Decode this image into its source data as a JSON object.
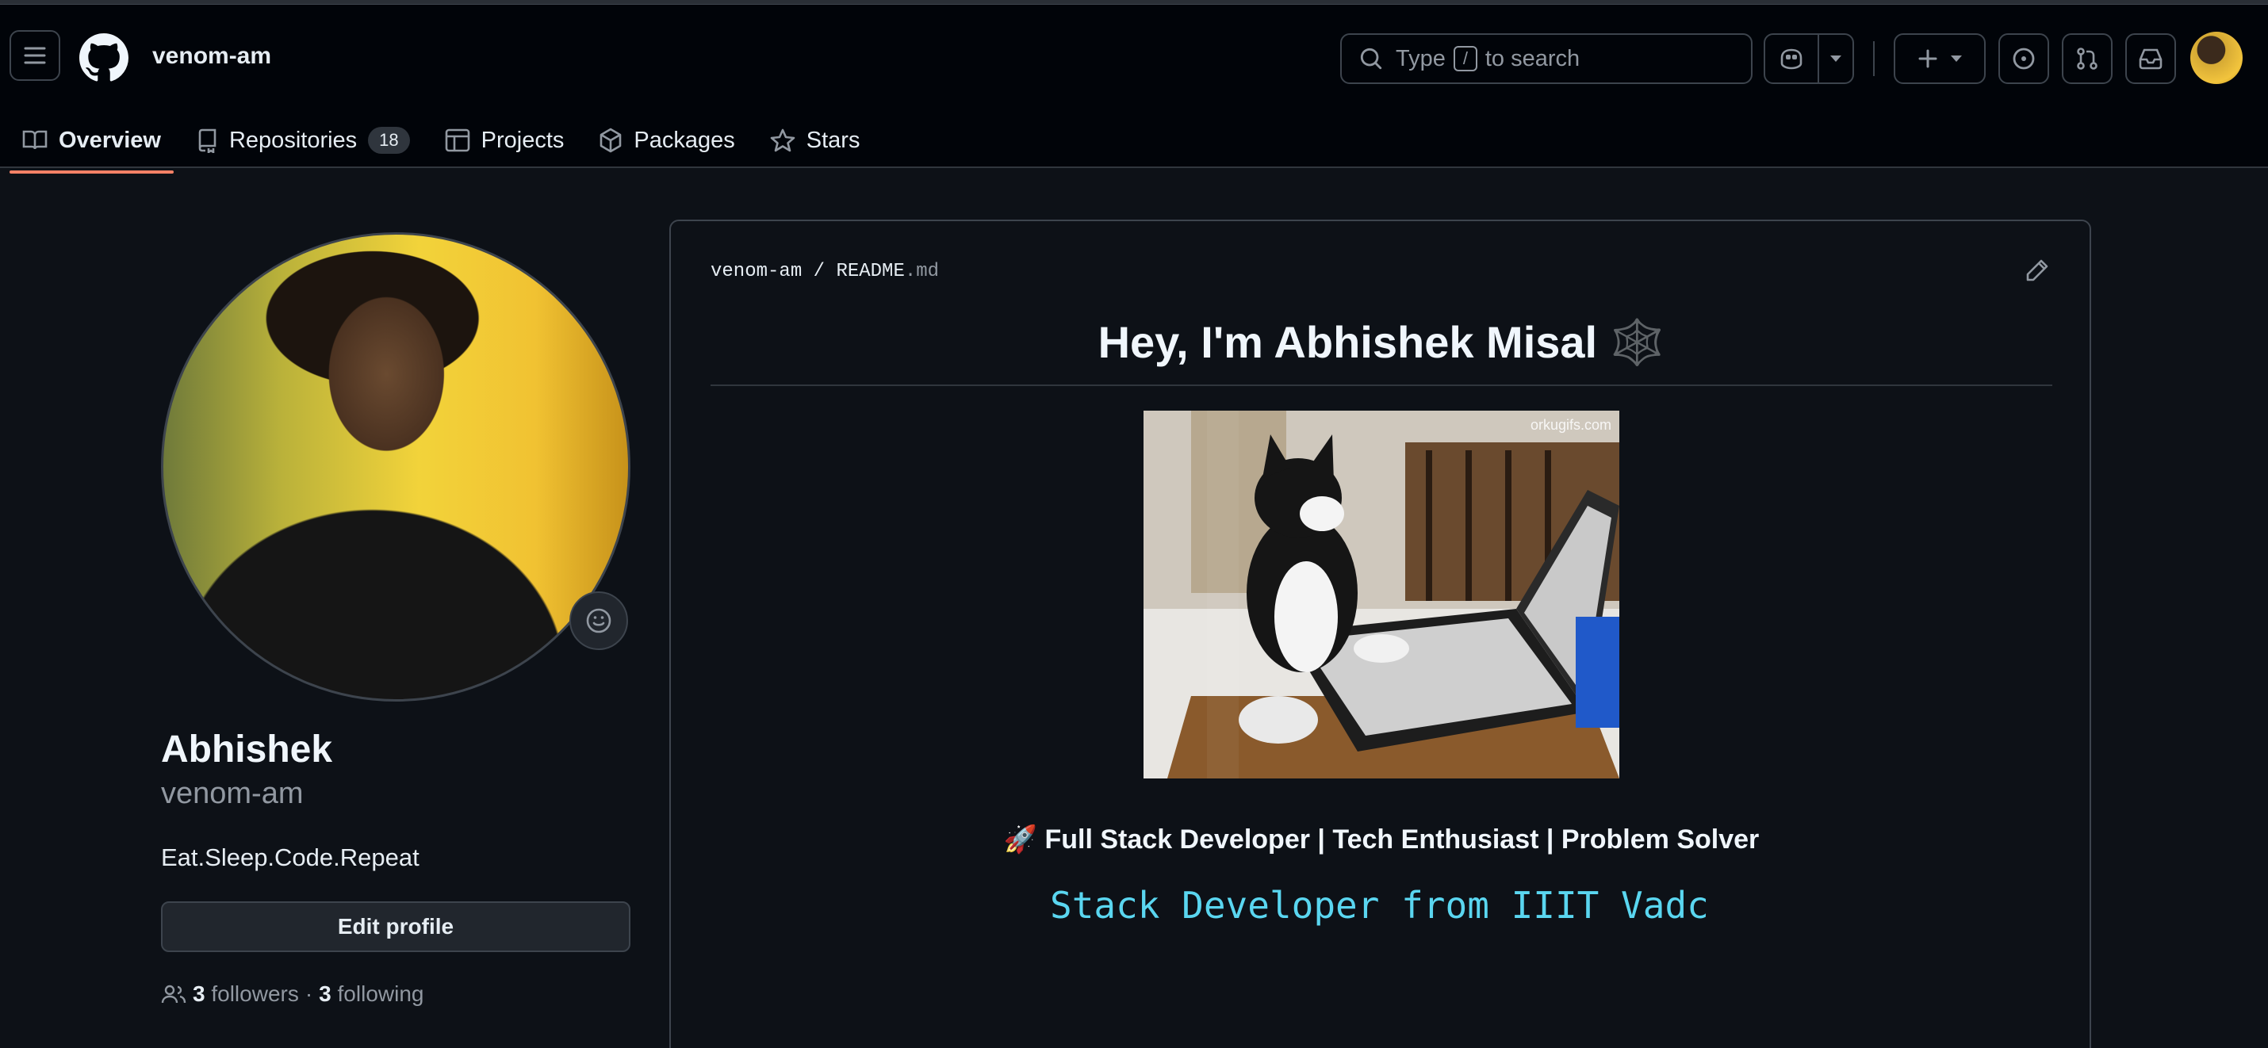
{
  "header": {
    "username": "venom-am",
    "search": {
      "prefix": "Type",
      "key": "/",
      "suffix": "to search"
    }
  },
  "nav": {
    "tabs": [
      {
        "label": "Overview",
        "selected": true
      },
      {
        "label": "Repositories",
        "count": "18"
      },
      {
        "label": "Projects"
      },
      {
        "label": "Packages"
      },
      {
        "label": "Stars"
      }
    ]
  },
  "profile": {
    "full_name": "Abhishek",
    "login": "venom-am",
    "bio": "Eat.Sleep.Code.Repeat",
    "edit_label": "Edit profile",
    "followers_count": "3",
    "followers_label": "followers",
    "separator": "·",
    "following_count": "3",
    "following_label": "following"
  },
  "readme": {
    "owner": "venom-am",
    "sep": "/",
    "file_base": "README",
    "file_ext": ".md",
    "title": "Hey, I'm Abhishek Misal 🕸️",
    "gif_watermark": "orkugifs.com",
    "tagline": "🚀 Full Stack Developer | Tech Enthusiast | Problem Solver",
    "typing_text": "Stack Developer from IIIT Vadc"
  },
  "colors": {
    "accent_underline": "#f78166",
    "typing": "#5ad6f0",
    "background": "#0d1117"
  }
}
